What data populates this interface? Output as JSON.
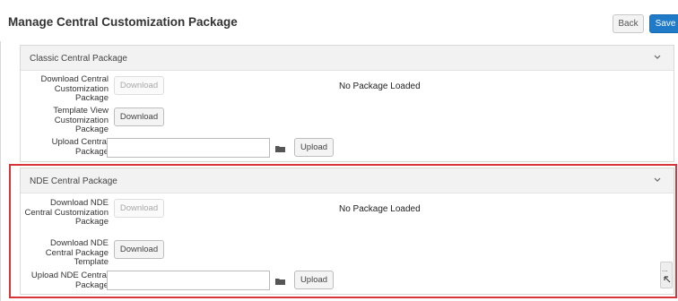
{
  "header": {
    "title": "Manage Central Customization Package",
    "back_label": "Back",
    "save_label": "Save"
  },
  "classic_section": {
    "title": "Classic Central Package",
    "rows": [
      {
        "label": "Download Central Customization Package",
        "button": "Download",
        "disabled": true,
        "status": "No Package Loaded"
      },
      {
        "label": "Template View Customization Package",
        "button": "Download",
        "disabled": false
      },
      {
        "label": "Upload Central Package",
        "upload_button": "Upload",
        "file_value": ""
      }
    ]
  },
  "nde_section": {
    "title": "NDE Central Package",
    "rows": [
      {
        "label": "Download NDE Central Customization Package",
        "button": "Download",
        "disabled": true,
        "status": "No Package Loaded"
      },
      {
        "label": "Download NDE Central Package Template",
        "button": "Download",
        "disabled": false
      },
      {
        "label": "Upload NDE Central Package",
        "upload_button": "Upload",
        "file_value": ""
      }
    ]
  },
  "side_tool": {
    "icon": "more-dots-icon",
    "label": "..."
  },
  "colors": {
    "accent": "#1f7ac8",
    "highlight": "#d9343a",
    "section_header": "#f2f2f2"
  }
}
